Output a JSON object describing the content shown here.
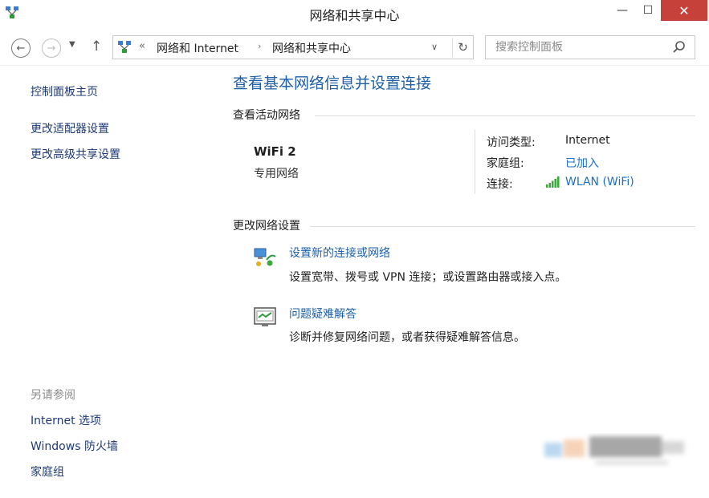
{
  "window": {
    "title": "网络和共享中心",
    "controls": {
      "minimize": "—",
      "maximize": "☐",
      "close": "✕"
    }
  },
  "nav": {
    "back_icon": "arrow-left-icon",
    "forward_icon": "arrow-right-icon",
    "up_icon": "arrow-up-icon",
    "address": {
      "overflow": "«",
      "crumbs": [
        "网络和 Internet",
        "网络和共享中心"
      ],
      "separator": "›"
    },
    "search": {
      "placeholder": "搜索控制面板",
      "value": ""
    }
  },
  "sidebar": {
    "home": "控制面板主页",
    "links": [
      "更改适配器设置",
      "更改高级共享设置"
    ],
    "see_also_title": "另请参阅",
    "see_also": [
      "Internet 选项",
      "Windows 防火墙",
      "家庭组"
    ]
  },
  "main": {
    "title": "查看基本网络信息并设置连接",
    "active_networks": {
      "heading": "查看活动网络",
      "network_name": "WiFi  2",
      "network_category": "专用网络",
      "properties": [
        {
          "label": "访问类型:",
          "value": "Internet"
        },
        {
          "label": "家庭组:",
          "value": "已加入"
        },
        {
          "label": "连接:",
          "value": "WLAN (WiFi)"
        }
      ]
    },
    "change_settings": {
      "heading": "更改网络设置",
      "tasks": [
        {
          "link": "设置新的连接或网络",
          "desc": "设置宽带、拨号或 VPN 连接；或设置路由器或接入点。",
          "icon": "new-connection-icon"
        },
        {
          "link": "问题疑难解答",
          "desc": "诊断并修复网络问题，或者获得疑难解答信息。",
          "icon": "troubleshoot-icon"
        }
      ]
    }
  },
  "colors": {
    "link": "#1e5fa8",
    "close_button": "#c7413b",
    "signal": "#3aa83a"
  }
}
